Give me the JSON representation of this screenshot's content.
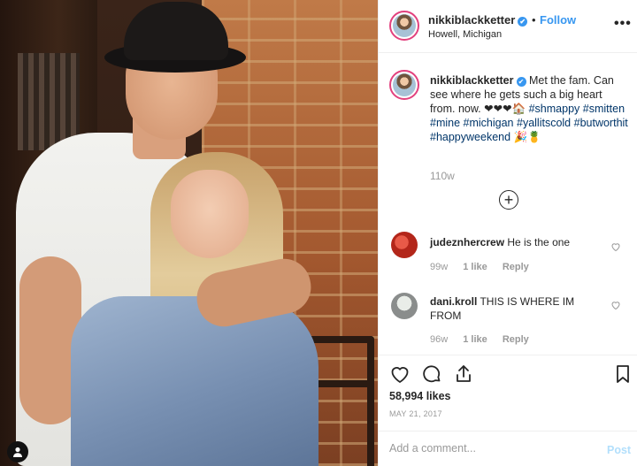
{
  "post": {
    "username": "nikkiblackketter",
    "verified_mark": "✔",
    "follow_label": "Follow",
    "separator": "•",
    "location": "Howell, Michigan",
    "more_label": "•••"
  },
  "caption": {
    "username": "nikkiblackketter",
    "text": "Met the fam. Can see where he gets such a big heart from. now. ❤❤❤🏠",
    "hashtags": [
      "#shmappy",
      "#smitten",
      "#mine",
      "#michigan",
      "#yallitscold",
      "#butworthit",
      "#happyweekend"
    ],
    "emoji_end": "🎉🍍",
    "time": "110w",
    "load_more": "+"
  },
  "comments": [
    {
      "username": "judeznhercrew",
      "text": "He is the one",
      "time": "99w",
      "likes": "1 like",
      "reply": "Reply"
    },
    {
      "username": "dani.kroll",
      "text": "THIS IS WHERE IM FROM",
      "time": "96w",
      "likes": "1 like",
      "reply": "Reply"
    }
  ],
  "stats": {
    "likes": "58,994 likes",
    "date": "MAY 21, 2017"
  },
  "composer": {
    "placeholder": "Add a comment...",
    "post_label": "Post"
  },
  "icons": [
    "heart-icon",
    "comment-icon",
    "share-icon",
    "bookmark-icon",
    "more-icon",
    "user-tag-icon",
    "add-circle-icon"
  ],
  "colors": {
    "link": "#3897f0",
    "hashtag": "#003569",
    "meta": "#999999",
    "verified": "#3897f0",
    "ring": "#e2417e"
  }
}
